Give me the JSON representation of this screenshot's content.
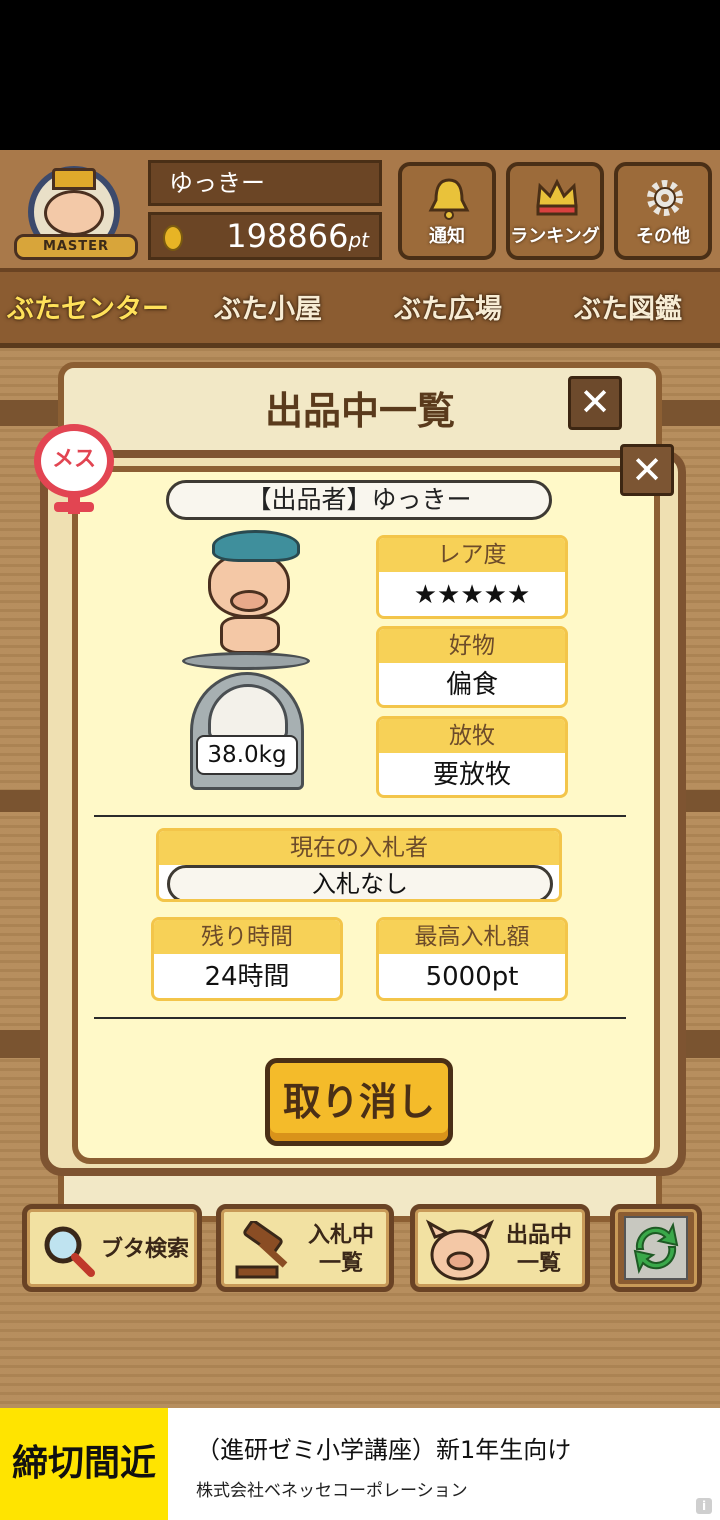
{
  "header": {
    "rank_badge": "MASTER",
    "user_name": "ゆっきー",
    "points": "198866",
    "points_unit": "pt",
    "buttons": [
      "通知",
      "ランキング",
      "その他"
    ]
  },
  "tabs": [
    "ぶたセンター",
    "ぶた小屋",
    "ぶた広場",
    "ぶた図鑑"
  ],
  "back_panel": {
    "title": "出品中一覧",
    "close": "✕"
  },
  "modal": {
    "close": "✕",
    "gender": "メス",
    "seller": "【出品者】ゆっきー",
    "weight": "38.0kg",
    "rarity_label": "レア度",
    "rarity_stars": "★★★★★",
    "favorite_label": "好物",
    "favorite_value": "偏食",
    "grazing_label": "放牧",
    "grazing_value": "要放牧",
    "bidder_label": "現在の入札者",
    "bidder_value": "入札なし",
    "time_label": "残り時間",
    "time_value": "24時間",
    "bid_label": "最高入札額",
    "bid_value": "5000pt",
    "cancel": "取り消し"
  },
  "bottom_nav": {
    "search": "ブタ検索",
    "bidding_l1": "入札中",
    "bidding_l2": "一覧",
    "listing_l1": "出品中",
    "listing_l2": "一覧"
  },
  "ad": {
    "tag": "締切間近",
    "title": "（進研ゼミ小学講座）新1年生向け",
    "advertiser": "株式会社ベネッセコーポレーション",
    "info": "i"
  },
  "colors": {
    "accent_yellow": "#f7d157",
    "wood": "#8b5c31",
    "star": "#ee6c6c",
    "gender": "#e24552"
  }
}
